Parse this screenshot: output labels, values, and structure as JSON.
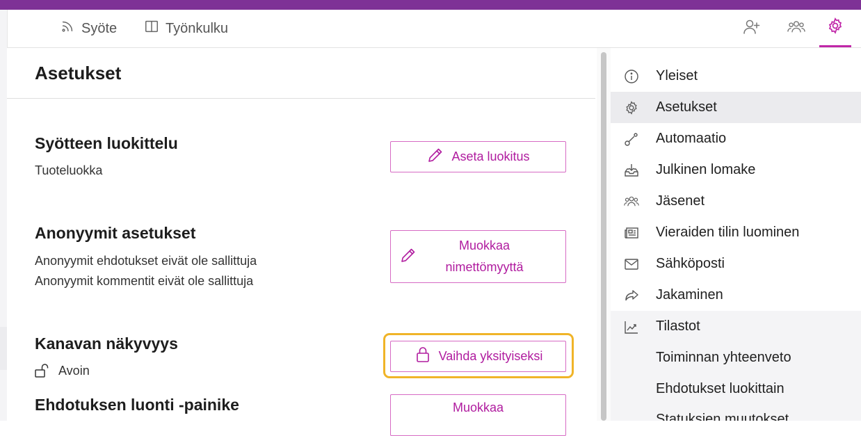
{
  "nav": {
    "tabs": [
      {
        "label": "Syöte",
        "icon": "rss-icon"
      },
      {
        "label": "Työnkulku",
        "icon": "columns-icon"
      }
    ],
    "icons": [
      "add-user-icon",
      "members-icon",
      "gear-icon"
    ],
    "accent": "#c026a8",
    "topbar_color": "#7e3296"
  },
  "page": {
    "title": "Asetukset"
  },
  "sections": {
    "classification": {
      "title": "Syötteen luokittelu",
      "text": "Tuoteluokka",
      "button": "Aseta luokitus"
    },
    "anonymous": {
      "title": "Anonyymit asetukset",
      "line1": "Anonyymit ehdotukset eivät ole sallittuja",
      "line2": "Anonyymit kommentit eivät ole sallittuja",
      "button_line1": "Muokkaa",
      "button_line2": "nimettömyyttä"
    },
    "visibility": {
      "title": "Kanavan näkyvyys",
      "status": "Avoin",
      "button": "Vaihda yksityiseksi"
    },
    "create_button": {
      "title": "Ehdotuksen luonti -painike",
      "button_line1": "Muokkaa"
    }
  },
  "sidebar": {
    "items": [
      {
        "label": "Yleiset",
        "icon": "info-icon"
      },
      {
        "label": "Asetukset",
        "icon": "gear-icon"
      },
      {
        "label": "Automaatio",
        "icon": "automation-icon"
      },
      {
        "label": "Julkinen lomake",
        "icon": "inbox-download-icon"
      },
      {
        "label": "Jäsenet",
        "icon": "members-icon"
      },
      {
        "label": "Vieraiden tilin luominen",
        "icon": "newspaper-icon"
      },
      {
        "label": "Sähköposti",
        "icon": "mail-icon"
      },
      {
        "label": "Jakaminen",
        "icon": "share-icon"
      },
      {
        "label": "Tilastot",
        "icon": "chart-icon"
      },
      {
        "label": "Toiminnan yhteenveto"
      },
      {
        "label": "Ehdotukset luokittain"
      },
      {
        "label": "Statuksien muutokset"
      }
    ]
  }
}
